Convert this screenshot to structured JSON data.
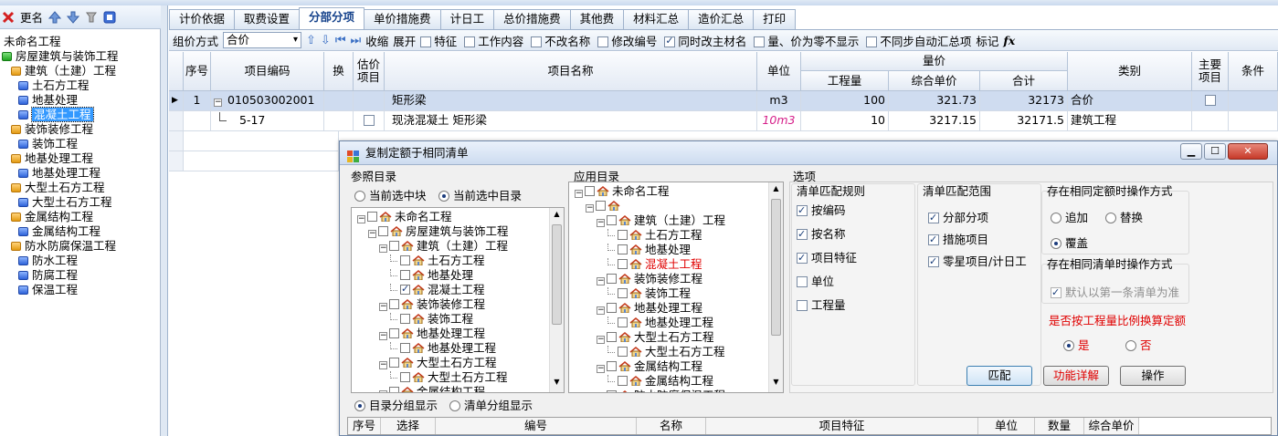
{
  "left_toolbar": {
    "delete_icon": "close-icon",
    "rename_label": "更名",
    "up_icon": "arrow-up-icon",
    "down_icon": "arrow-down-icon"
  },
  "left_tree": [
    {
      "label": "未命名工程",
      "level": 0,
      "icon": "none"
    },
    {
      "label": "房屋建筑与装饰工程",
      "level": 0,
      "icon": "green"
    },
    {
      "label": "建筑（土建）工程",
      "level": 1,
      "icon": "orange"
    },
    {
      "label": "土石方工程",
      "level": 2,
      "icon": "blue"
    },
    {
      "label": "地基处理",
      "level": 2,
      "icon": "blue"
    },
    {
      "label": "混凝土工程",
      "level": 2,
      "icon": "blue",
      "selected": true
    },
    {
      "label": "装饰装修工程",
      "level": 1,
      "icon": "orange"
    },
    {
      "label": "装饰工程",
      "level": 2,
      "icon": "blue"
    },
    {
      "label": "地基处理工程",
      "level": 1,
      "icon": "orange"
    },
    {
      "label": "地基处理工程",
      "level": 2,
      "icon": "blue"
    },
    {
      "label": "大型土石方工程",
      "level": 1,
      "icon": "orange"
    },
    {
      "label": "大型土石方工程",
      "level": 2,
      "icon": "blue"
    },
    {
      "label": "金属结构工程",
      "level": 1,
      "icon": "orange"
    },
    {
      "label": "金属结构工程",
      "level": 2,
      "icon": "blue"
    },
    {
      "label": "防水防腐保温工程",
      "level": 1,
      "icon": "orange"
    },
    {
      "label": "防水工程",
      "level": 2,
      "icon": "blue"
    },
    {
      "label": "防腐工程",
      "level": 2,
      "icon": "blue"
    },
    {
      "label": "保温工程",
      "level": 2,
      "icon": "blue"
    }
  ],
  "tabs": [
    "计价依据",
    "取费设置",
    "分部分项",
    "单价措施费",
    "计日工",
    "总价措施费",
    "其他费",
    "材料汇总",
    "造价汇总",
    "打印"
  ],
  "active_tab": "分部分项",
  "toolbar": {
    "combo_label": "组价方式",
    "combo_value": "合价",
    "collapse": "收缩",
    "expand": "展开",
    "checks": [
      {
        "label": "特征",
        "checked": false
      },
      {
        "label": "工作内容",
        "checked": false
      },
      {
        "label": "不改名称",
        "checked": false
      },
      {
        "label": "修改编号",
        "checked": false
      },
      {
        "label": "同时改主材名",
        "checked": true
      },
      {
        "label": "量、价为零不显示",
        "checked": false
      },
      {
        "label": "不同步自动汇总项",
        "checked": false
      }
    ],
    "mark": "标记",
    "fx": "fx"
  },
  "grid": {
    "headers": {
      "seq": "序号",
      "code": "项目编码",
      "swap": "换",
      "est": "估价项目",
      "name": "项目名称",
      "unit": "单位",
      "unit_price": "量价",
      "qty": "工程量",
      "composite": "综合单价",
      "total": "合计",
      "category": "类别",
      "main": "主要项目",
      "cond": "条件"
    },
    "rows": [
      {
        "seq": "1",
        "code": "010503002001",
        "name": "矩形梁",
        "unit": "m3",
        "qty": "100",
        "composite": "321.73",
        "total": "32173",
        "category": "合价"
      },
      {
        "seq": "",
        "code": "5-17",
        "name": "现浇混凝土 矩形梁",
        "unit": "10m3",
        "qty": "10",
        "composite": "3217.15",
        "total": "32171.5",
        "category": "建筑工程"
      }
    ]
  },
  "dialog": {
    "title": "复制定额于相同清单",
    "ref_title": "参照目录",
    "ref_radio1": "当前选中块",
    "ref_radio2": "当前选中目录",
    "ref_tree": [
      {
        "label": "未命名工程",
        "indent": 0,
        "checked": false,
        "red": false
      },
      {
        "label": "房屋建筑与装饰工程",
        "indent": 1,
        "checked": false,
        "red": false
      },
      {
        "label": "建筑（土建）工程",
        "indent": 2,
        "checked": false,
        "red": false
      },
      {
        "label": "土石方工程",
        "indent": 3,
        "checked": false,
        "red": false
      },
      {
        "label": "地基处理",
        "indent": 3,
        "checked": false,
        "red": false
      },
      {
        "label": "混凝土工程",
        "indent": 3,
        "checked": true,
        "red": false
      },
      {
        "label": "装饰装修工程",
        "indent": 2,
        "checked": false,
        "red": false
      },
      {
        "label": "装饰工程",
        "indent": 3,
        "checked": false,
        "red": false
      },
      {
        "label": "地基处理工程",
        "indent": 2,
        "checked": false,
        "red": false
      },
      {
        "label": "地基处理工程",
        "indent": 3,
        "checked": false,
        "red": false
      },
      {
        "label": "大型土石方工程",
        "indent": 2,
        "checked": false,
        "red": false
      },
      {
        "label": "大型土石方工程",
        "indent": 3,
        "checked": false,
        "red": false
      },
      {
        "label": "金属结构工程",
        "indent": 2,
        "checked": false,
        "red": false
      }
    ],
    "app_title": "应用目录",
    "app_tree": [
      {
        "label": "未命名工程",
        "indent": 0,
        "checked": false,
        "red": false
      },
      {
        "label": "",
        "indent": 1,
        "checked": false,
        "red": false
      },
      {
        "label": "建筑（土建）工程",
        "indent": 2,
        "checked": false,
        "red": false
      },
      {
        "label": "土石方工程",
        "indent": 3,
        "checked": false,
        "red": false
      },
      {
        "label": "地基处理",
        "indent": 3,
        "checked": false,
        "red": false
      },
      {
        "label": "混凝土工程",
        "indent": 3,
        "checked": false,
        "red": true
      },
      {
        "label": "装饰装修工程",
        "indent": 2,
        "checked": false,
        "red": false
      },
      {
        "label": "装饰工程",
        "indent": 3,
        "checked": false,
        "red": false
      },
      {
        "label": "地基处理工程",
        "indent": 2,
        "checked": false,
        "red": false
      },
      {
        "label": "地基处理工程",
        "indent": 3,
        "checked": false,
        "red": false
      },
      {
        "label": "大型土石方工程",
        "indent": 2,
        "checked": false,
        "red": false
      },
      {
        "label": "大型土石方工程",
        "indent": 3,
        "checked": false,
        "red": false
      },
      {
        "label": "金属结构工程",
        "indent": 2,
        "checked": false,
        "red": false
      },
      {
        "label": "金属结构工程",
        "indent": 3,
        "checked": false,
        "red": false
      },
      {
        "label": "防水防腐保温工程",
        "indent": 2,
        "checked": false,
        "red": false
      }
    ],
    "options_title": "选项",
    "match_rule_title": "清单匹配规则",
    "match_rules": [
      {
        "label": "按编码",
        "checked": true
      },
      {
        "label": "按名称",
        "checked": true
      },
      {
        "label": "项目特征",
        "checked": true
      },
      {
        "label": "单位",
        "checked": false
      },
      {
        "label": "工程量",
        "checked": false
      }
    ],
    "match_range_title": "清单匹配范围",
    "match_ranges": [
      {
        "label": "分部分项",
        "checked": true
      },
      {
        "label": "措施项目",
        "checked": true
      },
      {
        "label": "零星项目/计日工",
        "checked": true
      }
    ],
    "same_quota_title": "存在相同定额时操作方式",
    "append": "追加",
    "replace": "替换",
    "overwrite": "覆盖",
    "same_list_title": "存在相同清单时操作方式",
    "default_first": "默认以第一条清单为准",
    "ratio_title": "是否按工程量比例换算定额",
    "yes": "是",
    "no": "否",
    "btn_match": "匹配",
    "btn_detail": "功能详解",
    "btn_operate": "操作",
    "disp1": "目录分组显示",
    "disp2": "清单分组显示",
    "bottom_headers": [
      "序号",
      "选择",
      "编号",
      "名称",
      "项目特征",
      "单位",
      "数量",
      "综合单价"
    ]
  }
}
